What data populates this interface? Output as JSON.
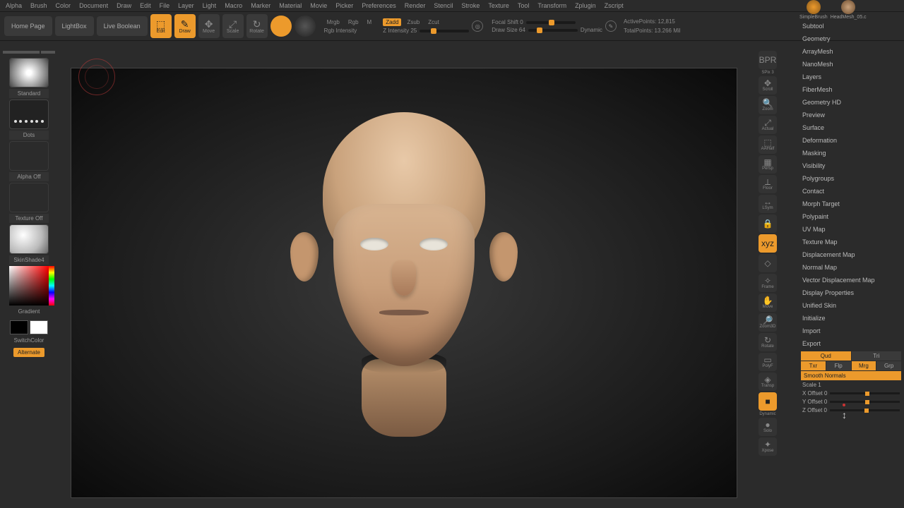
{
  "menu": [
    "Alpha",
    "Brush",
    "Color",
    "Document",
    "Draw",
    "Edit",
    "File",
    "Layer",
    "Light",
    "Macro",
    "Marker",
    "Material",
    "Movie",
    "Picker",
    "Preferences",
    "Render",
    "Stencil",
    "Stroke",
    "Texture",
    "Tool",
    "Transform",
    "Zplugin",
    "Zscript"
  ],
  "toolbar": {
    "home": "Home Page",
    "lightbox": "LightBox",
    "liveboolean": "Live Boolean",
    "edit": "Edit",
    "draw": "Draw",
    "move": "Move",
    "scale": "Scale",
    "rotate": "Rotate",
    "mrgb": "Mrgb",
    "rgb": "Rgb",
    "m": "M",
    "rgb_intensity": "Rgb Intensity",
    "zadd": "Zadd",
    "zsub": "Zsub",
    "zcut": "Zcut",
    "zintensity": "Z Intensity 25",
    "focal": "Focal Shift 0",
    "drawsize": "Draw Size 64",
    "dynamic": "Dynamic",
    "active_pts": "ActivePoints: 12,815",
    "total_pts": "TotalPoints: 13.266 Mil"
  },
  "left": {
    "brush": "Standard",
    "stroke": "Dots",
    "alpha": "Alpha Off",
    "texture": "Texture Off",
    "material": "SkinShade4",
    "gradient": "Gradient",
    "switch": "SwitchColor",
    "alternate": "Alternate"
  },
  "right_icons": [
    {
      "g": "BPR",
      "l": "",
      "sub": "SPix 3"
    },
    {
      "g": "✥",
      "l": "Scroll"
    },
    {
      "g": "🔍",
      "l": "Zoom"
    },
    {
      "g": "⤢",
      "l": "Actual"
    },
    {
      "g": "⬚",
      "l": "AAHalf"
    },
    {
      "g": "▦",
      "l": "Persp"
    },
    {
      "g": "⟂",
      "l": "Floor"
    },
    {
      "g": "↔",
      "l": "LSym"
    },
    {
      "g": "🔒",
      "l": ""
    },
    {
      "g": "xyz",
      "l": "",
      "active": true
    },
    {
      "g": "◇",
      "l": ""
    },
    {
      "g": "✧",
      "l": "Frame"
    },
    {
      "g": "✋",
      "l": "Move"
    },
    {
      "g": "🔎",
      "l": "Zoom3D"
    },
    {
      "g": "↻",
      "l": "Rotate"
    },
    {
      "g": "▭",
      "l": "PolyF"
    },
    {
      "g": "◈",
      "l": "Transp"
    },
    {
      "g": "■",
      "l": "",
      "active": true,
      "sub": "Dynamic"
    },
    {
      "g": "●",
      "l": "Solo"
    },
    {
      "g": "✦",
      "l": "Xpose"
    }
  ],
  "projects": [
    {
      "name": "SimpleBrush"
    },
    {
      "name": "HeadMesh_05.c"
    }
  ],
  "sections": [
    "Subtool",
    "Geometry",
    "ArrayMesh",
    "NanoMesh",
    "Layers",
    "FiberMesh",
    "Geometry HD",
    "Preview",
    "Surface",
    "Deformation",
    "Masking",
    "Visibility",
    "Polygroups",
    "Contact",
    "Morph Target",
    "Polypaint",
    "UV Map",
    "Texture Map",
    "Displacement Map",
    "Normal Map",
    "Vector Displacement Map",
    "Display Properties",
    "Unified Skin",
    "Initialize",
    "Import",
    "Export"
  ],
  "export": {
    "qud": "Qud",
    "tri": "Tri",
    "txr": "Txr",
    "flp": "Flp",
    "mrg": "Mrg",
    "grp": "Grp",
    "smooth": "Smooth Normals",
    "scale": "Scale 1",
    "xoff": "X Offset 0",
    "yoff": "Y Offset 0",
    "zoff": "Z Offset 0"
  }
}
